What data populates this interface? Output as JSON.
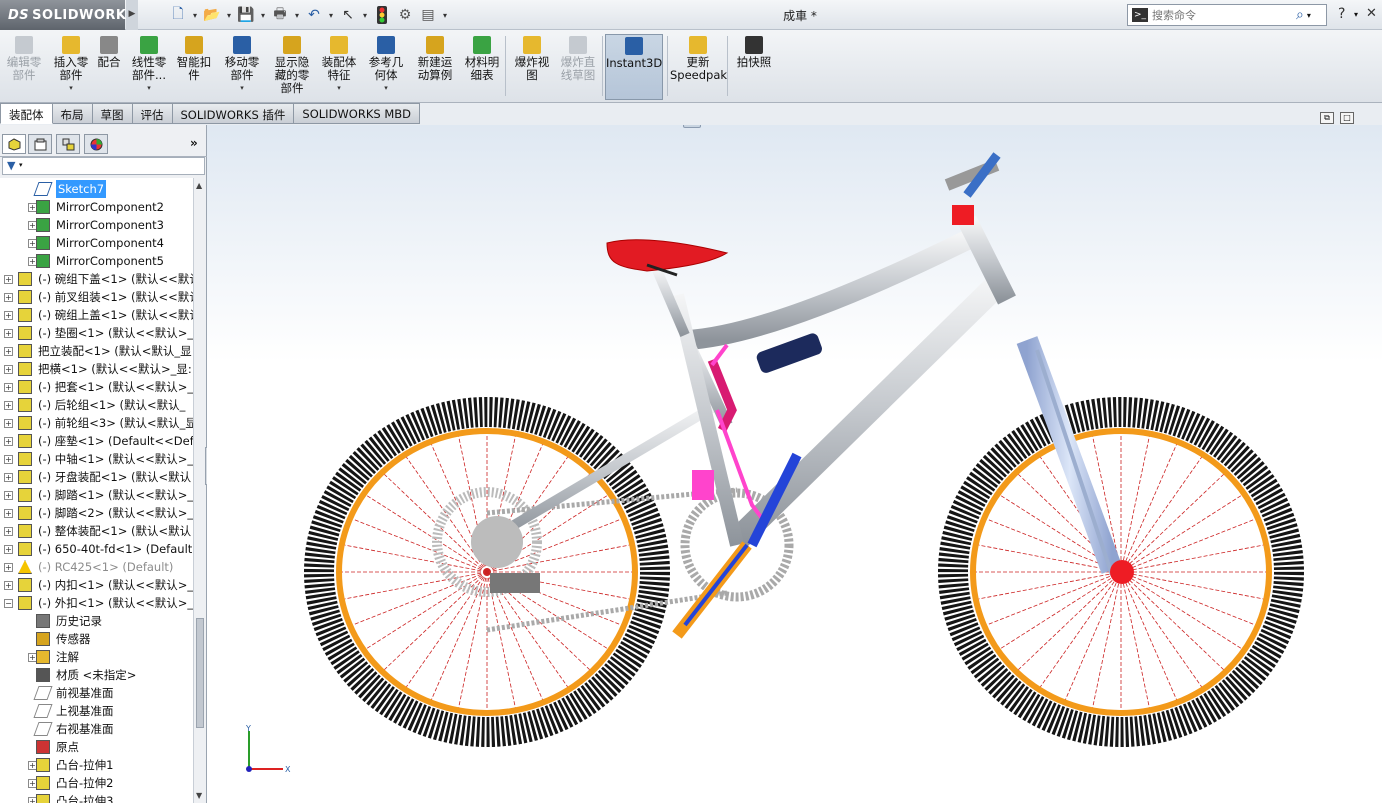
{
  "app": {
    "brand": "SOLIDWORKS",
    "brand_prefix": "DS",
    "document_title": "成車 *"
  },
  "search": {
    "placeholder": "搜索命令"
  },
  "quick_access": [
    "new-icon",
    "open-icon",
    "save-icon",
    "print-icon",
    "undo-icon",
    "select-icon",
    "rebuild-icon",
    "options-icon",
    "customize-icon"
  ],
  "commands": [
    {
      "id": "edit-part",
      "label1": "编辑零",
      "label2": "部件",
      "label3": "",
      "icon": "edit-component-icon",
      "disabled": true,
      "dropdown": false
    },
    {
      "id": "insert-part",
      "label1": "插入零",
      "label2": "部件",
      "label3": "",
      "icon": "insert-component-icon",
      "disabled": false,
      "dropdown": true
    },
    {
      "id": "mate",
      "label1": "配合",
      "label2": "",
      "label3": "",
      "icon": "mate-icon",
      "disabled": false,
      "dropdown": false
    },
    {
      "id": "linear-pattern",
      "label1": "线性零",
      "label2": "部件...",
      "label3": "",
      "icon": "linear-pattern-icon",
      "disabled": false,
      "dropdown": true
    },
    {
      "id": "smart-fasteners",
      "label1": "智能扣",
      "label2": "件",
      "label3": "",
      "icon": "smart-fastener-icon",
      "disabled": false,
      "dropdown": false
    },
    {
      "id": "move-part",
      "label1": "移动零",
      "label2": "部件",
      "label3": "",
      "icon": "move-component-icon",
      "disabled": false,
      "dropdown": true
    },
    {
      "id": "show-hidden",
      "label1": "显示隐",
      "label2": "藏的零",
      "label3": "部件",
      "icon": "show-hidden-icon",
      "disabled": false,
      "dropdown": false
    },
    {
      "id": "assembly-feature",
      "label1": "装配体",
      "label2": "特征",
      "label3": "",
      "icon": "assembly-feature-icon",
      "disabled": false,
      "dropdown": true
    },
    {
      "id": "reference-geometry",
      "label1": "参考几",
      "label2": "何体",
      "label3": "",
      "icon": "reference-geometry-icon",
      "disabled": false,
      "dropdown": true
    },
    {
      "id": "new-motion-study",
      "label1": "新建运",
      "label2": "动算例",
      "label3": "",
      "icon": "motion-study-icon",
      "disabled": false,
      "dropdown": false
    },
    {
      "id": "bom",
      "label1": "材料明",
      "label2": "细表",
      "label3": "",
      "icon": "bom-icon",
      "disabled": false,
      "dropdown": false
    },
    {
      "id": "exploded-view",
      "label1": "爆炸视",
      "label2": "图",
      "label3": "",
      "icon": "exploded-view-icon",
      "disabled": false,
      "dropdown": false
    },
    {
      "id": "explode-line",
      "label1": "爆炸直",
      "label2": "线草图",
      "label3": "",
      "icon": "explode-line-sketch-icon",
      "disabled": true,
      "dropdown": false
    },
    {
      "id": "instant3d",
      "label1": "Instant3D",
      "label2": "",
      "label3": "",
      "icon": "instant3d-icon",
      "disabled": false,
      "dropdown": false,
      "active": true
    },
    {
      "id": "speedpak",
      "label1": "更新",
      "label2": "Speedpak",
      "label3": "",
      "icon": "speedpak-icon",
      "disabled": false,
      "dropdown": false
    },
    {
      "id": "snapshot",
      "label1": "拍快照",
      "label2": "",
      "label3": "",
      "icon": "snapshot-icon",
      "disabled": false,
      "dropdown": false
    }
  ],
  "tabs": [
    "装配体",
    "布局",
    "草图",
    "评估",
    "SOLIDWORKS 插件",
    "SOLIDWORKS MBD"
  ],
  "tree": [
    {
      "label": "Sketch7",
      "indent": 2,
      "icon": "sketch-icon",
      "expand": false,
      "selected": true
    },
    {
      "label": "MirrorComponent2",
      "indent": 1,
      "icon": "mirror-component-icon",
      "expand": true
    },
    {
      "label": "MirrorComponent3",
      "indent": 1,
      "icon": "mirror-component-icon",
      "expand": true
    },
    {
      "label": "MirrorComponent4",
      "indent": 1,
      "icon": "mirror-component-icon",
      "expand": true
    },
    {
      "label": "MirrorComponent5",
      "indent": 1,
      "icon": "mirror-component-icon",
      "expand": true
    },
    {
      "label": "(-) 碗组下盖<1> (默认<<默认",
      "indent": 0,
      "icon": "assembly-icon",
      "expand": true
    },
    {
      "label": "(-) 前叉组装<1> (默认<<默认",
      "indent": 0,
      "icon": "assembly-icon",
      "expand": true
    },
    {
      "label": "(-) 碗组上盖<1> (默认<<默认",
      "indent": 0,
      "icon": "assembly-icon",
      "expand": true
    },
    {
      "label": "(-) 垫圈<1> (默认<<默认>_",
      "indent": 0,
      "icon": "assembly-icon",
      "expand": true
    },
    {
      "label": "把立装配<1> (默认<默认_显",
      "indent": 0,
      "icon": "assembly-icon",
      "expand": true
    },
    {
      "label": "把横<1> (默认<<默认>_显:",
      "indent": 0,
      "icon": "assembly-icon",
      "expand": true
    },
    {
      "label": "(-) 把套<1> (默认<<默认>_",
      "indent": 0,
      "icon": "assembly-icon",
      "expand": true
    },
    {
      "label": "(-) 后轮组<1> (默认<默认_",
      "indent": 0,
      "icon": "assembly-icon",
      "expand": true
    },
    {
      "label": "(-) 前轮组<3> (默认<默认_显",
      "indent": 0,
      "icon": "assembly-icon",
      "expand": true
    },
    {
      "label": "(-) 座墊<1> (Default<<Def",
      "indent": 0,
      "icon": "assembly-icon",
      "expand": true
    },
    {
      "label": "(-) 中轴<1> (默认<<默认>_",
      "indent": 0,
      "icon": "assembly-icon",
      "expand": true
    },
    {
      "label": "(-) 牙盘装配<1> (默认<默认",
      "indent": 0,
      "icon": "assembly-icon",
      "expand": true
    },
    {
      "label": "(-) 脚踏<1> (默认<<默认>_",
      "indent": 0,
      "icon": "assembly-icon",
      "expand": true
    },
    {
      "label": "(-) 脚踏<2> (默认<<默认>_",
      "indent": 0,
      "icon": "assembly-icon",
      "expand": true
    },
    {
      "label": "(-) 整体装配<1> (默认<默认",
      "indent": 0,
      "icon": "assembly-icon",
      "expand": true
    },
    {
      "label": "(-) 650-40t-fd<1> (Default",
      "indent": 0,
      "icon": "assembly-icon",
      "expand": true
    },
    {
      "label": "(-) RC425<1> (Default)",
      "indent": 0,
      "icon": "warning-icon",
      "expand": true,
      "muted": true
    },
    {
      "label": "(-) 内扣<1> (默认<<默认>_",
      "indent": 0,
      "icon": "assembly-icon",
      "expand": true
    },
    {
      "label": "(-) 外扣<1> (默认<<默认>_",
      "indent": 0,
      "icon": "assembly-icon",
      "expand": true,
      "open": true
    },
    {
      "label": "历史记录",
      "indent": 2,
      "icon": "history-icon",
      "expand": false
    },
    {
      "label": "传感器",
      "indent": 2,
      "icon": "sensor-icon",
      "expand": false
    },
    {
      "label": "注解",
      "indent": 1,
      "icon": "annotation-icon",
      "expand": true
    },
    {
      "label": "材质 <未指定>",
      "indent": 2,
      "icon": "material-icon",
      "expand": false
    },
    {
      "label": "前视基准面",
      "indent": 2,
      "icon": "plane-icon",
      "expand": false
    },
    {
      "label": "上视基准面",
      "indent": 2,
      "icon": "plane-icon",
      "expand": false
    },
    {
      "label": "右视基准面",
      "indent": 2,
      "icon": "plane-icon",
      "expand": false
    },
    {
      "label": "原点",
      "indent": 2,
      "icon": "origin-icon",
      "expand": false
    },
    {
      "label": "凸台-拉伸1",
      "indent": 1,
      "icon": "extrude-icon",
      "expand": true
    },
    {
      "label": "凸台-拉伸2",
      "indent": 1,
      "icon": "extrude-icon",
      "expand": true
    },
    {
      "label": "凸台-拉伸3",
      "indent": 1,
      "icon": "extrude-icon",
      "expand": true
    }
  ],
  "triad": {
    "x_label": "X",
    "y_label": "Y"
  },
  "colors": {
    "frame": "#c9cdd2",
    "tire": "#151515",
    "rim": "#f39a1a",
    "spoke": "#cc2222",
    "saddle": "#e21b23",
    "fork": "#b8c8e6",
    "shock": "#1c2a5c",
    "hub": "#ee1c24",
    "pink": "#ff44cc",
    "link_blue": "#2444d8"
  }
}
